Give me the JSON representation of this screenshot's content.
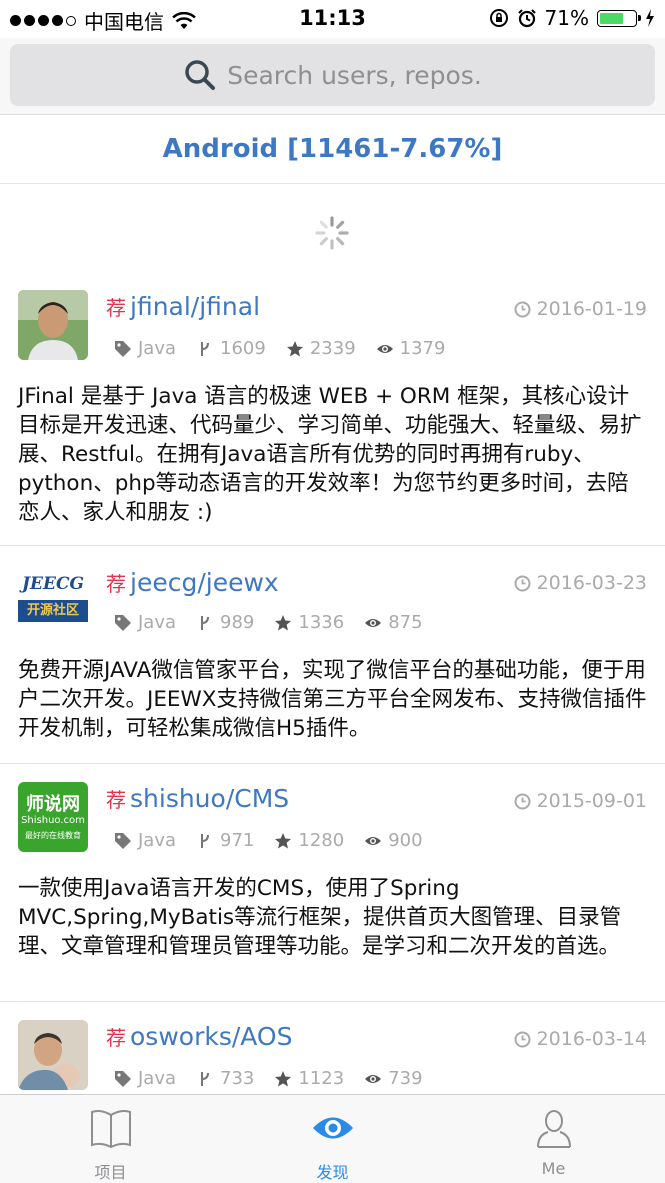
{
  "status_bar": {
    "carrier": "中国电信",
    "time": "11:13",
    "battery_text": "71%",
    "battery_level": 0.71
  },
  "search": {
    "placeholder": "Search users, repos.",
    "icon": "search-icon"
  },
  "topic": {
    "title": "Android [11461-7.67%]"
  },
  "repos": [
    {
      "rec_mark": "荐",
      "name": "jfinal/jfinal",
      "date": "2016-01-19",
      "language": "Java",
      "forks": "1609",
      "stars": "2339",
      "watchers": "1379",
      "description": "JFinal 是基于 Java 语言的极速 WEB + ORM 框架，其核心设计目标是开发迅速、代码量少、学习简单、功能强大、轻量级、易扩展、Restful。在拥有Java语言所有优势的同时再拥有ruby、python、php等动态语言的开发效率！为您节约更多时间，去陪恋人、家人和朋友 :)"
    },
    {
      "rec_mark": "荐",
      "name": "jeecg/jeewx",
      "date": "2016-03-23",
      "language": "Java",
      "forks": "989",
      "stars": "1336",
      "watchers": "875",
      "avatar_text_top": "JEECG",
      "avatar_text_bottom": "开源社区",
      "description": "免费开源JAVA微信管家平台，实现了微信平台的基础功能，便于用户二次开发。JEEWX支持微信第三方平台全网发布、支持微信插件开发机制，可轻松集成微信H5插件。"
    },
    {
      "rec_mark": "荐",
      "name": "shishuo/CMS",
      "date": "2015-09-01",
      "language": "Java",
      "forks": "971",
      "stars": "1280",
      "watchers": "900",
      "avatar_text_top": "师说网",
      "avatar_text_mid": "Shishuo.com",
      "avatar_text_bottom": "最好的在线教育",
      "description": "一款使用Java语言开发的CMS，使用了Spring MVC,Spring,MyBatis等流行框架，提供首页大图管理、目录管理、文章管理和管理员管理等功能。是学习和二次开发的首选。"
    },
    {
      "rec_mark": "荐",
      "name": "osworks/AOS",
      "date": "2016-03-14",
      "language": "Java",
      "forks": "733",
      "stars": "1123",
      "watchers": "739"
    }
  ],
  "tabs": [
    {
      "label": "项目",
      "icon": "book-icon"
    },
    {
      "label": "发现",
      "icon": "eye-icon",
      "active": true
    },
    {
      "label": "Me",
      "icon": "person-icon"
    }
  ],
  "colors": {
    "accent": "#3e78c3",
    "rec": "#e0344a",
    "tab_active": "#2a8be6",
    "meta": "#aaaaaa"
  }
}
